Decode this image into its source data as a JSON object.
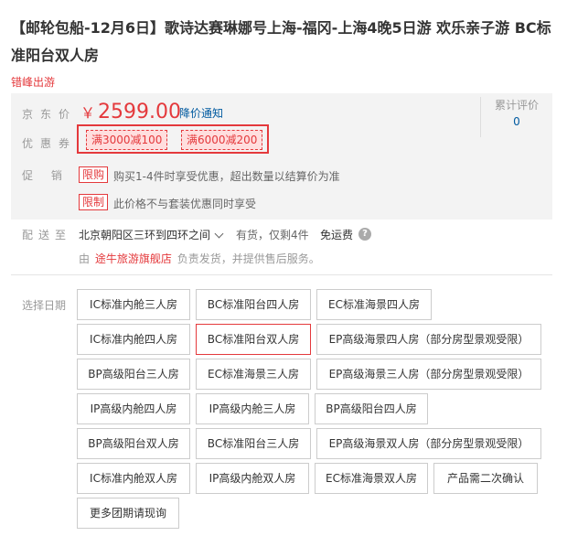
{
  "product": {
    "title": "【邮轮包船-12月6日】歌诗达赛琳娜号上海-福冈-上海4晚5日游 欢乐亲子游 BC标准阳台双人房",
    "promo_link": "错峰出游"
  },
  "price_section": {
    "price_label": "京东价",
    "currency": "￥",
    "price": "2599.00",
    "price_notice": "降价通知",
    "review_label": "累计评价",
    "review_count": "0",
    "coupon_label": "优惠券",
    "coupons": [
      "满3000减100",
      "满6000减200"
    ],
    "promo_label": "促 销",
    "promotions": [
      {
        "tag": "限购",
        "text": "购买1-4件时享受优惠，超出数量以结算价为准"
      },
      {
        "tag": "限制",
        "text": "此价格不与套装优惠同时享受"
      }
    ]
  },
  "shipping": {
    "label": "配送至",
    "area": "北京朝阳区三环到四环之间",
    "stock": "有货，仅剩4件",
    "free_shipping": "免运费",
    "seller_prefix": "由",
    "seller_name": "途牛旅游旗舰店",
    "seller_suffix": "负责发货，并提供售后服务。"
  },
  "options": {
    "label": "选择日期",
    "selected_index": 4,
    "items": [
      "IC标准内舱三人房",
      "BC标准阳台四人房",
      "EC标准海景四人房",
      "IC标准内舱四人房",
      "BC标准阳台双人房",
      "EP高级海景四人房（部分房型景观受限）",
      "BP高级阳台三人房",
      "EC标准海景三人房",
      "EP高级海景三人房（部分房型景观受限）",
      "IP高级内舱四人房",
      "IP高级内舱三人房",
      "BP高级阳台四人房",
      "BP高级阳台双人房",
      "BC标准阳台三人房",
      "EP高级海景双人房（部分房型景观受限）",
      "IC标准内舱双人房",
      "IP高级内舱双人房",
      "EC标准海景双人房",
      "产品需二次确认",
      "更多团期请现询"
    ]
  },
  "colors": {
    "accent": "#e4393c",
    "link": "#005aa0",
    "panel": "#f3f3f3"
  },
  "icons": {
    "help": "question-circle-icon",
    "dropdown": "chevron-down-icon"
  }
}
